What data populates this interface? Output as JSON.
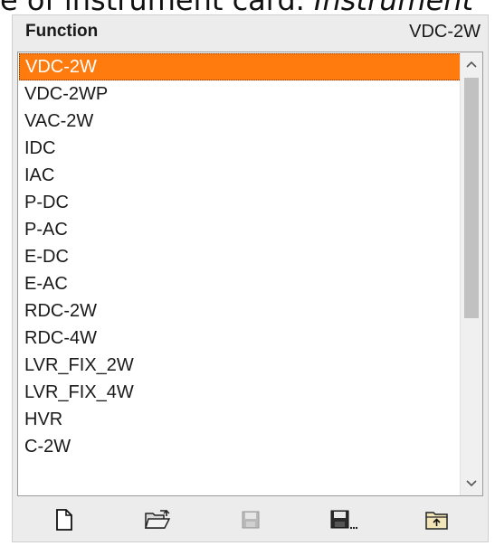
{
  "doc_fragment": {
    "plain": "e of instrument card. ",
    "italic": "Instrument"
  },
  "panel": {
    "title": "Function",
    "current_value": "VDC-2W"
  },
  "list": {
    "selected_index": 0,
    "items": [
      "VDC-2W",
      "VDC-2WP",
      "VAC-2W",
      "IDC",
      "IAC",
      "P-DC",
      "P-AC",
      "E-DC",
      "E-AC",
      "RDC-2W",
      "RDC-4W",
      "LVR_FIX_2W",
      "LVR_FIX_4W",
      "HVR",
      "C-2W"
    ]
  },
  "toolbar": {
    "buttons": [
      {
        "icon": "new-document-icon",
        "enabled": true
      },
      {
        "icon": "open-folder-icon",
        "enabled": true
      },
      {
        "icon": "save-icon",
        "enabled": false
      },
      {
        "icon": "save-as-icon",
        "enabled": true
      },
      {
        "icon": "import-icon",
        "enabled": true
      }
    ]
  },
  "colors": {
    "selection": "#ff7b0d",
    "panel_bg": "#ececec"
  }
}
